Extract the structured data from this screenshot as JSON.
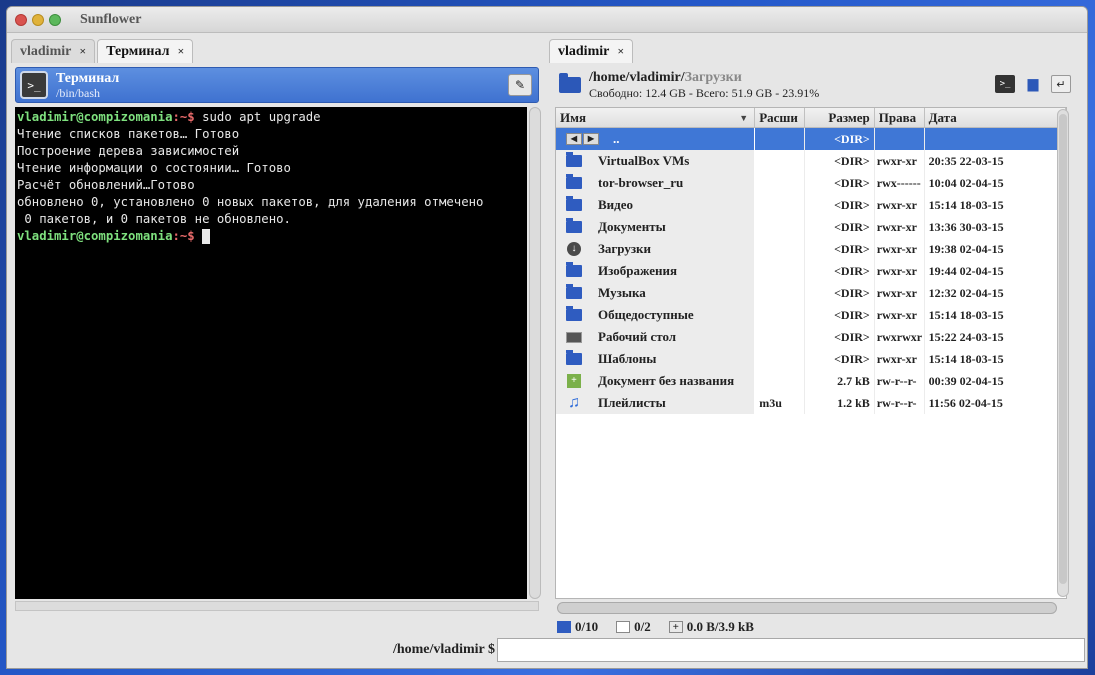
{
  "window": {
    "title": "Sunflower"
  },
  "left": {
    "tabs": [
      {
        "label": "vladimir",
        "close": "×"
      },
      {
        "label": "Терминал",
        "close": "×"
      }
    ],
    "header": {
      "icon_text": ">_",
      "title": "Терминал",
      "subtitle": "/bin/bash",
      "edit_icon": "✎"
    },
    "terminal": {
      "user": "vladimir@compizomania",
      "sep": ":~$",
      "command": " sudo apt upgrade",
      "output": [
        "Чтение списков пакетов… Готово",
        "Построение дерева зависимостей",
        "Чтение информации о состоянии… Готово",
        "Расчёт обновлений…Готово",
        "обновлено 0, установлено 0 новых пакетов, для удаления отмечено",
        " 0 пакетов, и 0 пакетов не обновлено."
      ]
    }
  },
  "right": {
    "tabs": [
      {
        "label": "vladimir",
        "close": "×"
      }
    ],
    "path_base": "/home/vladimir/",
    "path_current": "Загрузки",
    "free": "Свободно: 12.4 GB - Всего: 51.9 GB - 23.91%",
    "header_icons": [
      "terminal-icon",
      "folder-icon",
      "return-icon"
    ],
    "columns": {
      "name": "Имя",
      "ext": "Расши",
      "size": "Размер",
      "perm": "Права",
      "date": "Дата"
    },
    "rows": [
      {
        "icon": "updir",
        "name": "..",
        "ext": "",
        "size": "<DIR>",
        "perm": "",
        "date": "",
        "selected": true
      },
      {
        "icon": "folder",
        "name": "VirtualBox VMs",
        "ext": "",
        "size": "<DIR>",
        "perm": "rwxr-xr",
        "date": "20:35 22-03-15"
      },
      {
        "icon": "folder",
        "name": "tor-browser_ru",
        "ext": "",
        "size": "<DIR>",
        "perm": "rwx------",
        "date": "10:04 02-04-15"
      },
      {
        "icon": "folder",
        "name": "Видео",
        "ext": "",
        "size": "<DIR>",
        "perm": "rwxr-xr",
        "date": "15:14 18-03-15"
      },
      {
        "icon": "folder",
        "name": "Документы",
        "ext": "",
        "size": "<DIR>",
        "perm": "rwxr-xr",
        "date": "13:36 30-03-15"
      },
      {
        "icon": "download",
        "name": "Загрузки",
        "ext": "",
        "size": "<DIR>",
        "perm": "rwxr-xr",
        "date": "19:38 02-04-15"
      },
      {
        "icon": "folder",
        "name": "Изображения",
        "ext": "",
        "size": "<DIR>",
        "perm": "rwxr-xr",
        "date": "19:44 02-04-15"
      },
      {
        "icon": "folder",
        "name": "Музыка",
        "ext": "",
        "size": "<DIR>",
        "perm": "rwxr-xr",
        "date": "12:32 02-04-15"
      },
      {
        "icon": "folder",
        "name": "Общедоступные",
        "ext": "",
        "size": "<DIR>",
        "perm": "rwxr-xr",
        "date": "15:14 18-03-15"
      },
      {
        "icon": "desktop",
        "name": "Рабочий стол",
        "ext": "",
        "size": "<DIR>",
        "perm": "rwxrwxr",
        "date": "15:22 24-03-15"
      },
      {
        "icon": "folder",
        "name": "Шаблоны",
        "ext": "",
        "size": "<DIR>",
        "perm": "rwxr-xr",
        "date": "15:14 18-03-15"
      },
      {
        "icon": "document",
        "name": "Документ без названия",
        "ext": "",
        "size": "2.7 kB",
        "perm": "rw-r--r-",
        "date": "00:39 02-04-15"
      },
      {
        "icon": "music",
        "name": "Плейлисты",
        "ext": "m3u",
        "size": "1.2 kB",
        "perm": "rw-r--r-",
        "date": "11:56 02-04-15"
      }
    ],
    "status": {
      "dirs": "0/10",
      "files": "0/2",
      "size": "0.0 B/3.9 kB"
    }
  },
  "bottom": {
    "prompt": "/home/vladimir $",
    "input_value": ""
  }
}
